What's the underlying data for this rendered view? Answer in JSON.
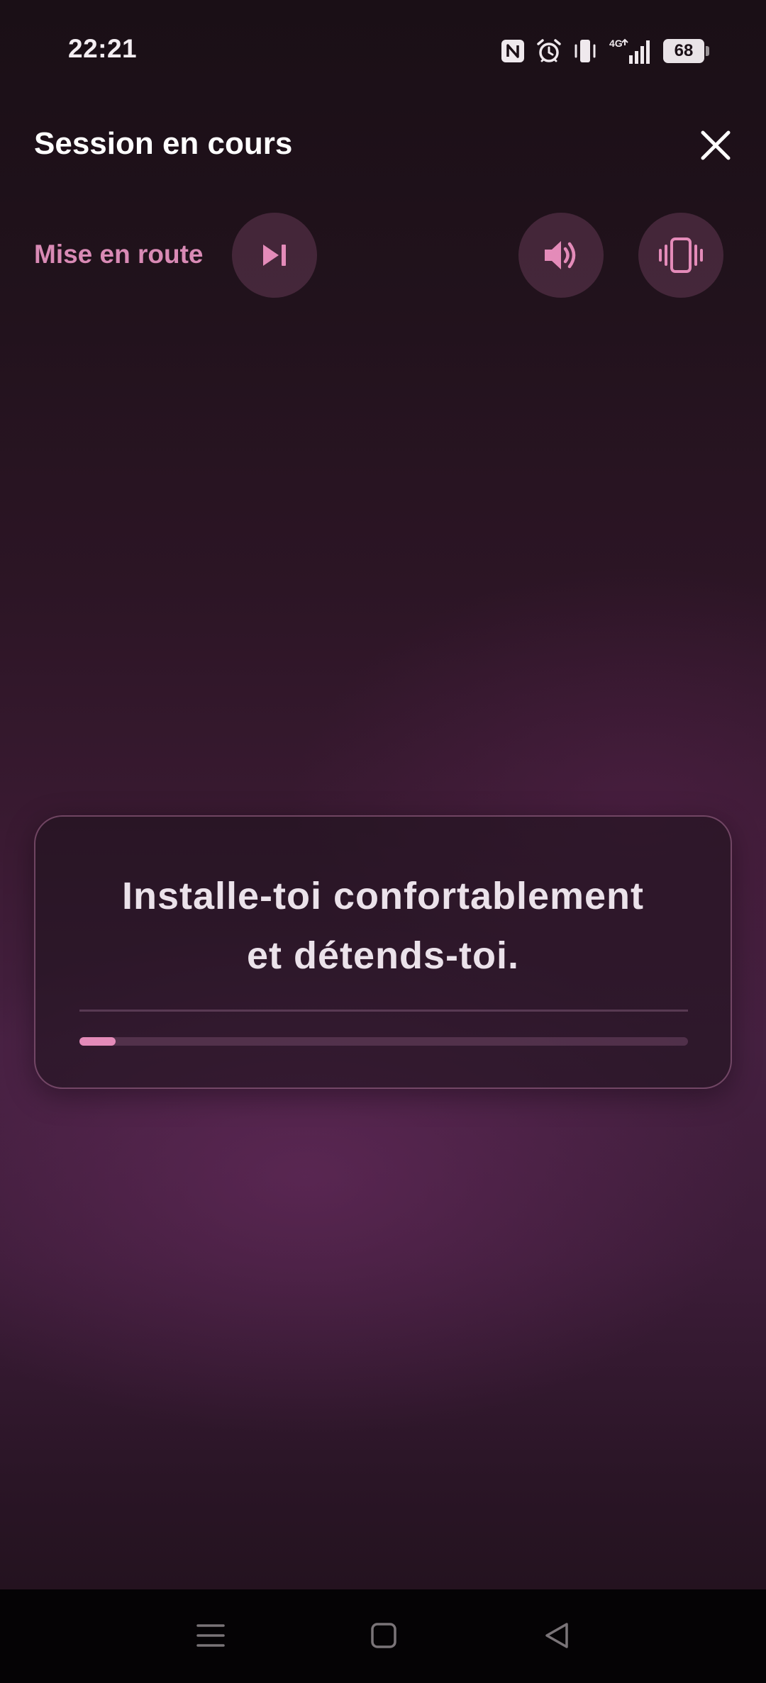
{
  "status_bar": {
    "time": "22:21",
    "battery_level": "68",
    "network": "4G",
    "icons": [
      "nfc-icon",
      "alarm-icon",
      "vibrate-mode-icon",
      "signal-icon",
      "battery-icon"
    ]
  },
  "header": {
    "title": "Session en cours",
    "close_icon": "close-icon"
  },
  "controls": {
    "phase_label": "Mise en route",
    "skip_icon": "skip-next-icon",
    "sound_icon": "volume-icon",
    "vibration_icon": "vibration-icon"
  },
  "instruction": {
    "line1": "Installe-toi confortablement",
    "line2": "et détends-toi.",
    "progress": 0.06
  },
  "colors": {
    "accent": "#e48bb9",
    "phase_label": "#d98ab5",
    "background_dark": "#1a0f16",
    "background_mid": "#452040"
  },
  "nav_bar": {
    "icons": [
      "menu-icon",
      "home-icon",
      "back-icon"
    ]
  }
}
